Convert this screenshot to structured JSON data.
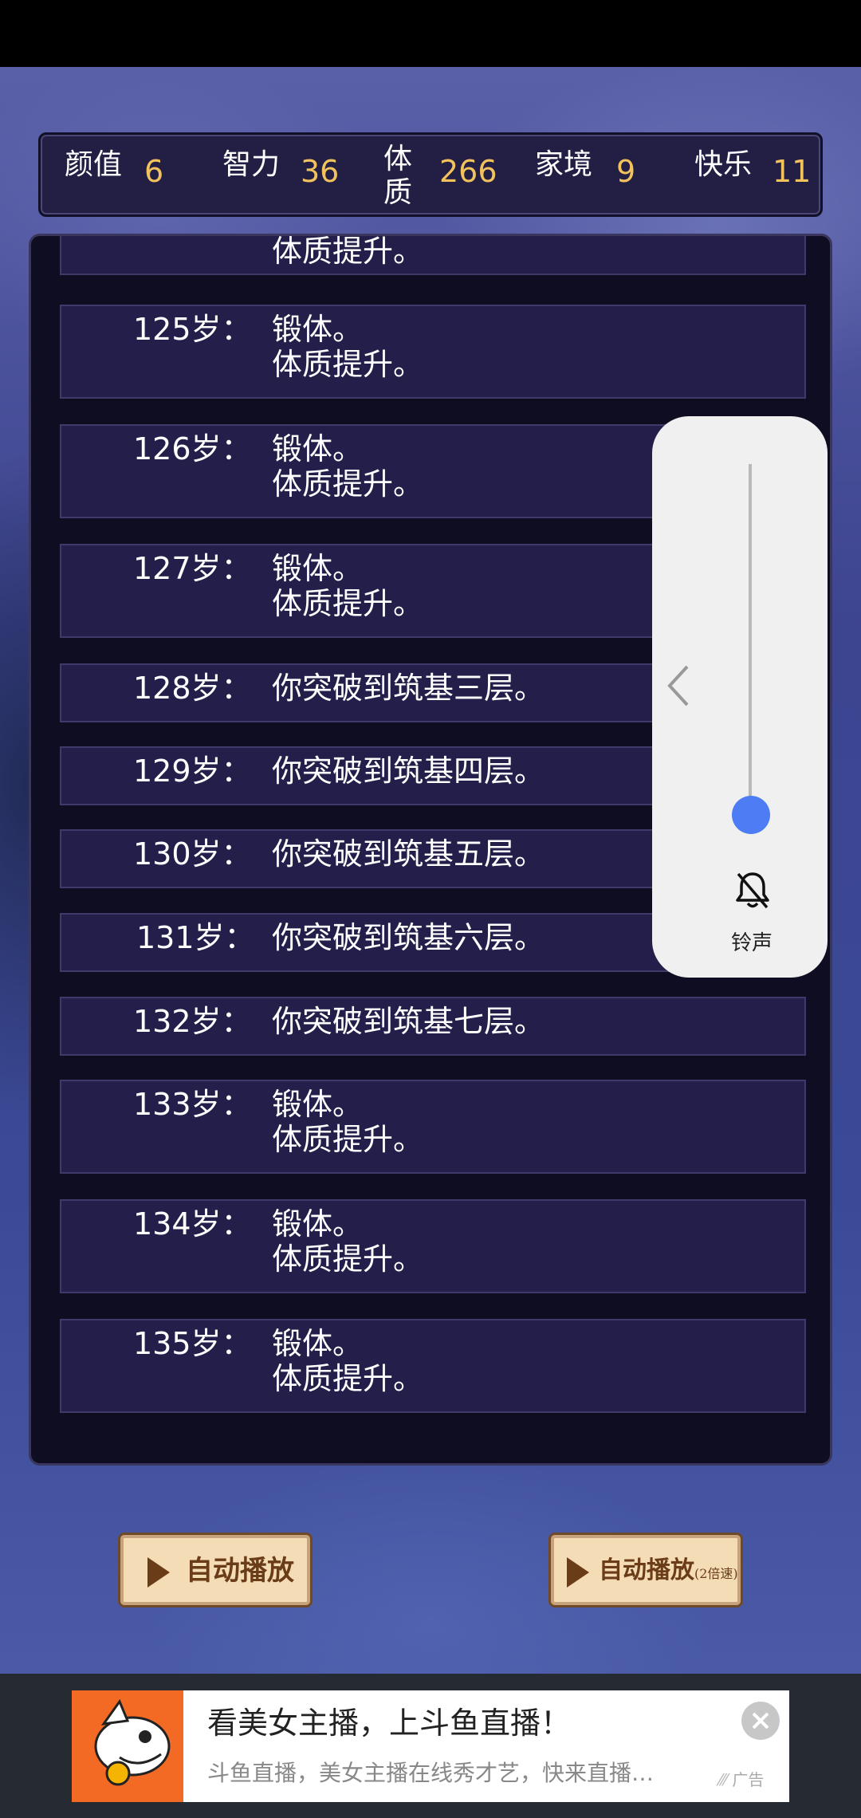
{
  "stats": [
    {
      "label": "颜值",
      "value": "6"
    },
    {
      "label": "智力",
      "value": "36"
    },
    {
      "label": "体质",
      "value": "266"
    },
    {
      "label": "家境",
      "value": "9"
    },
    {
      "label": "快乐",
      "value": "11"
    }
  ],
  "log": [
    {
      "age": "",
      "line1": "",
      "line2": "体质提升。"
    },
    {
      "age": "125岁：",
      "line1": "锻体。",
      "line2": "体质提升。"
    },
    {
      "age": "126岁：",
      "line1": "锻体。",
      "line2": "体质提升。"
    },
    {
      "age": "127岁：",
      "line1": "锻体。",
      "line2": "体质提升。"
    },
    {
      "age": "128岁：",
      "line1": "你突破到筑基三层。",
      "line2": ""
    },
    {
      "age": "129岁：",
      "line1": "你突破到筑基四层。",
      "line2": ""
    },
    {
      "age": "130岁：",
      "line1": "你突破到筑基五层。",
      "line2": ""
    },
    {
      "age": "131岁：",
      "line1": "你突破到筑基六层。",
      "line2": ""
    },
    {
      "age": "132岁：",
      "line1": "你突破到筑基七层。",
      "line2": ""
    },
    {
      "age": "133岁：",
      "line1": "锻体。",
      "line2": "体质提升。"
    },
    {
      "age": "134岁：",
      "line1": "锻体。",
      "line2": "体质提升。"
    },
    {
      "age": "135岁：",
      "line1": "锻体。",
      "line2": "体质提升。"
    }
  ],
  "buttons": {
    "autoplay": "自动播放",
    "autoplay2x": "自动播放",
    "autoplay2x_sub": "(2倍速)"
  },
  "volume": {
    "label": "铃声",
    "level": 0.0
  },
  "ad": {
    "title": "看美女主播，上斗鱼直播！",
    "desc": "斗鱼直播，美女主播在线秀才艺，快来直播…",
    "tag": "广告"
  },
  "colors": {
    "stat_value": "#f2c25c",
    "panel_bg": "#0f0d22",
    "row_bg": "#231f4a",
    "slider_accent": "#4d7cf5"
  }
}
